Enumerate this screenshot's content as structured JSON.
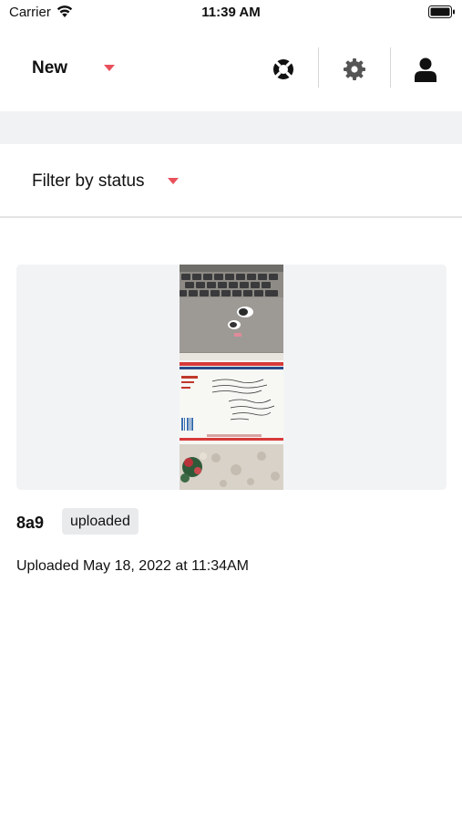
{
  "status_bar": {
    "carrier": "Carrier",
    "time": "11:39 AM"
  },
  "nav": {
    "title": "New",
    "icons": [
      "lifebuoy-icon",
      "gear-icon",
      "user-icon"
    ],
    "accent_color": "#e8505b"
  },
  "filter": {
    "label": "Filter by status"
  },
  "item": {
    "id": "8a9",
    "status_badge": "uploaded",
    "uploaded_text": "Uploaded May 18, 2022 at 11:34AM"
  }
}
